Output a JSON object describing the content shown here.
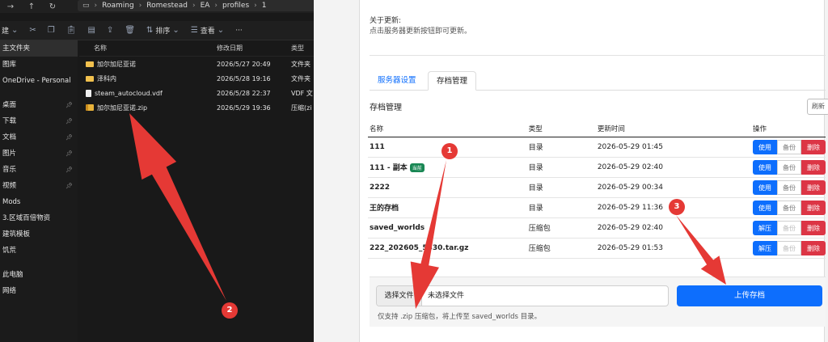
{
  "explorer": {
    "nav": {
      "back": "←",
      "forward": "→",
      "up": "↑",
      "refresh": "↻"
    },
    "breadcrumb": [
      "Roaming",
      "Romestead",
      "EA",
      "profiles",
      "1"
    ],
    "toolbar": {
      "new_label": "建",
      "sort_label": "排序",
      "view_label": "查看",
      "more_label": "···"
    },
    "sidebar": [
      {
        "label": "主文件夹",
        "active": true,
        "pinned": false
      },
      {
        "label": "图库",
        "pinned": false
      },
      {
        "label": "OneDrive - Personal",
        "pinned": false
      },
      {
        "label": "桌面",
        "pinned": true
      },
      {
        "label": "下载",
        "pinned": true
      },
      {
        "label": "文档",
        "pinned": true
      },
      {
        "label": "图片",
        "pinned": true
      },
      {
        "label": "音乐",
        "pinned": true
      },
      {
        "label": "视频",
        "pinned": true
      },
      {
        "label": "Mods",
        "pinned": false
      },
      {
        "label": "3.区域百倍物资",
        "pinned": false
      },
      {
        "label": "建筑模板",
        "pinned": false
      },
      {
        "label": "饥荒",
        "pinned": false
      },
      {
        "label": "此电脑",
        "pinned": false
      },
      {
        "label": "网络",
        "pinned": false
      }
    ],
    "columns": {
      "name": "名称",
      "modified": "修改日期",
      "type": "类型"
    },
    "files": [
      {
        "name": "加尔加尼亚诺",
        "modified": "2026/5/27 20:49",
        "type": "文件夹",
        "icon": "folder-icon"
      },
      {
        "name": "泽科内",
        "modified": "2026/5/28 19:16",
        "type": "文件夹",
        "icon": "folder-icon"
      },
      {
        "name": "steam_autocloud.vdf",
        "modified": "2026/5/28 22:37",
        "type": "VDF 文",
        "icon": "file-icon"
      },
      {
        "name": "加尔加尼亚诺.zip",
        "modified": "2026/5/29 19:36",
        "type": "压缩(zi",
        "icon": "zip-icon"
      }
    ]
  },
  "app": {
    "update_title": "关于更新:",
    "update_desc": "点击服务器更新按钮即可更新。",
    "tabs": [
      {
        "label": "服务器设置",
        "active": false
      },
      {
        "label": "存档管理",
        "active": true
      }
    ],
    "section_title": "存档管理",
    "refresh_label": "刷新",
    "table": {
      "headers": {
        "name": "名称",
        "type": "类型",
        "time": "更新时间",
        "ops": "操作"
      },
      "rows": [
        {
          "name": "111",
          "badge": "",
          "type": "目录",
          "time": "2026-05-29 01:45",
          "primary": "使用",
          "backup": "备份",
          "delete": "删除",
          "backup_disabled": false
        },
        {
          "name": "111 - 副本",
          "badge": "当前",
          "type": "目录",
          "time": "2026-05-29 02:40",
          "primary": "使用",
          "backup": "备份",
          "delete": "删除",
          "backup_disabled": false
        },
        {
          "name": "2222",
          "badge": "",
          "type": "目录",
          "time": "2026-05-29 00:34",
          "primary": "使用",
          "backup": "备份",
          "delete": "删除",
          "backup_disabled": false
        },
        {
          "name": "王的存档",
          "badge": "",
          "type": "目录",
          "time": "2026-05-29 11:36",
          "primary": "使用",
          "backup": "备份",
          "delete": "删除",
          "backup_disabled": false
        },
        {
          "name": "saved_worlds",
          "badge": "",
          "type": "压缩包",
          "time": "2026-05-29 02:40",
          "primary": "解压",
          "backup": "备份",
          "delete": "删除",
          "backup_disabled": true
        },
        {
          "name": "222_202605_5330.tar.gz",
          "badge": "",
          "type": "压缩包",
          "time": "2026-05-29 01:53",
          "primary": "解压",
          "backup": "备份",
          "delete": "删除",
          "backup_disabled": true
        }
      ]
    },
    "upload": {
      "choose_label": "选择文件",
      "no_file_label": "未选择文件",
      "upload_label": "上传存档",
      "hint": "仅支持 .zip 压缩包，将上传至 saved_worlds 目录。"
    }
  },
  "annotations": {
    "color": "#e53935",
    "markers": [
      {
        "label": "1"
      },
      {
        "label": "2"
      },
      {
        "label": "3"
      }
    ]
  }
}
